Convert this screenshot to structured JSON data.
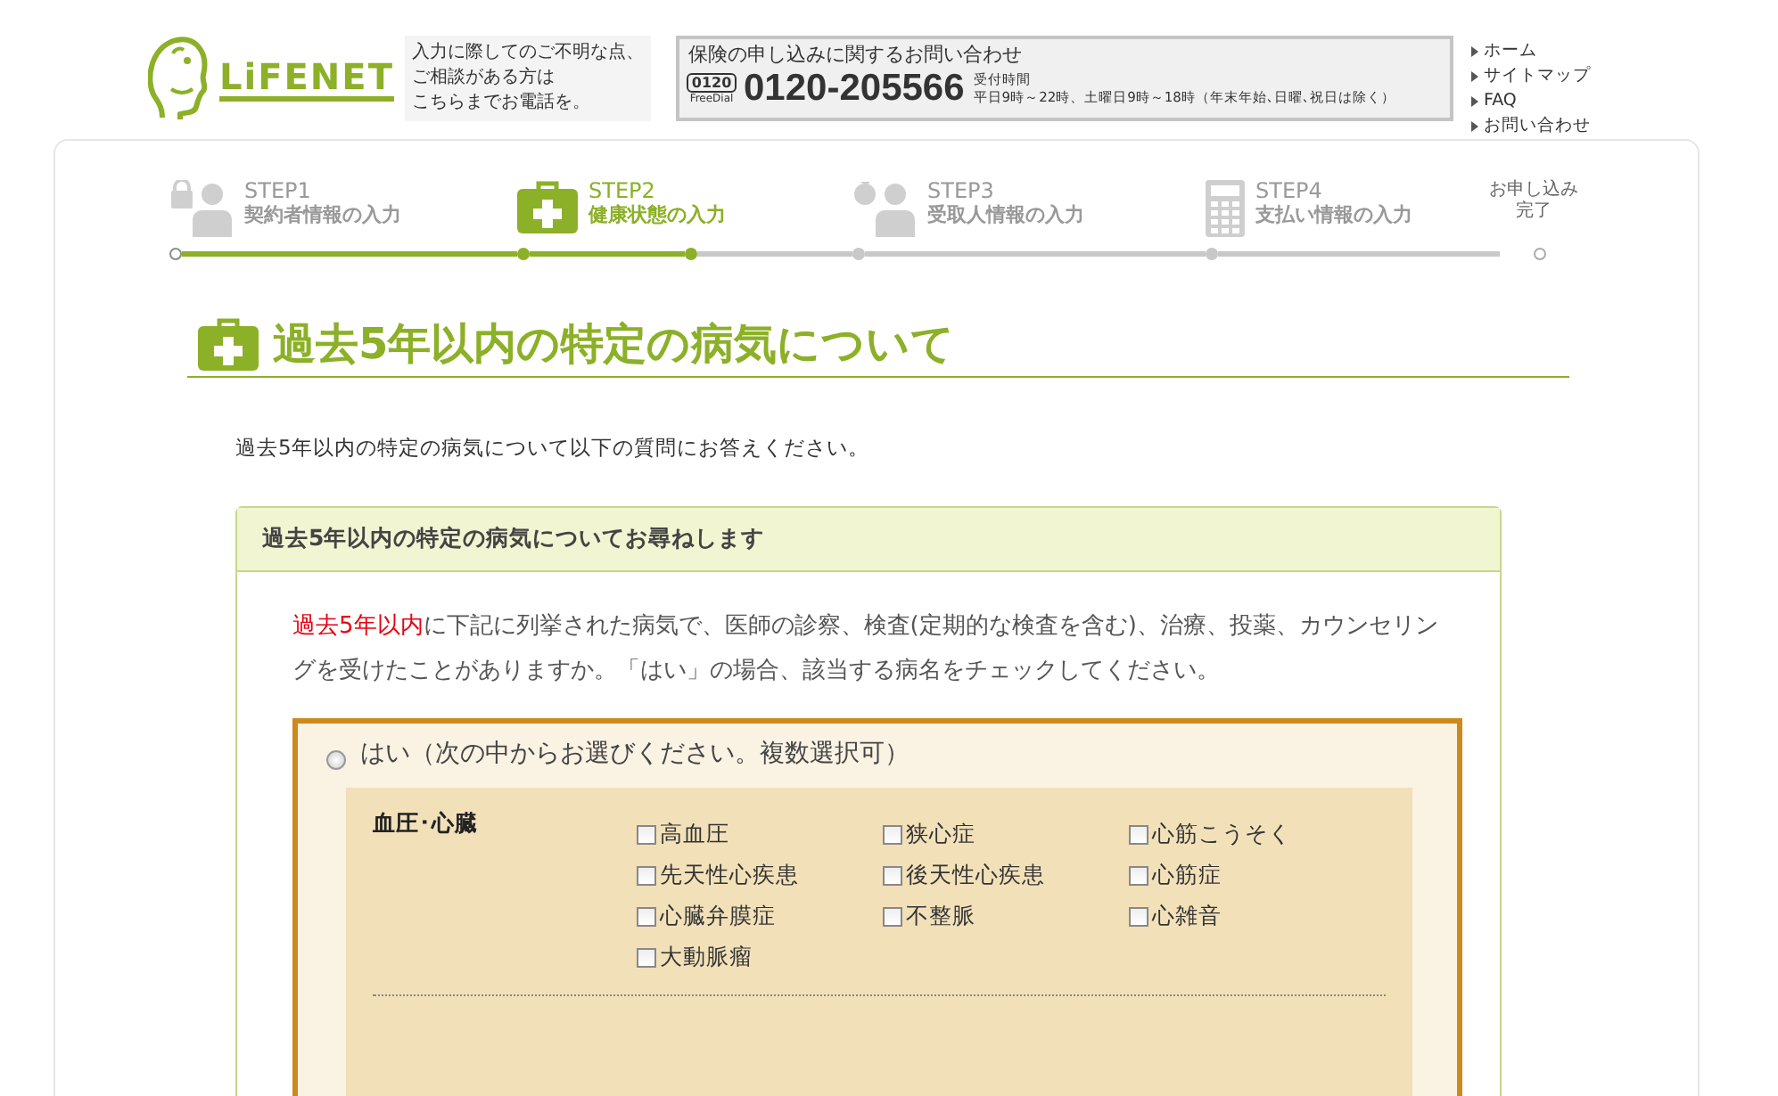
{
  "header": {
    "logo_text": "LiFENET",
    "notice": [
      "入力に際してのご不明な点、",
      "ご相談がある方は",
      "こちらまでお電話を。"
    ],
    "contact": {
      "title": "保険の申し込みに関するお問い合わせ",
      "freedial_mark": "0120",
      "freedial_label": "FreeDial",
      "phone": "0120-205566",
      "hours_label": "受付時間",
      "hours": "平日9時～22時、土曜日9時～18時（年末年始､日曜､祝日は除く）"
    },
    "links": [
      "ホーム",
      "サイトマップ",
      "FAQ",
      "お問い合わせ"
    ]
  },
  "steps": [
    {
      "kind": "lock-person",
      "step": "STEP1",
      "label": "契約者情報の入力",
      "completed": true,
      "selected": false
    },
    {
      "kind": "medkit",
      "step": "STEP2",
      "label": "健康状態の入力",
      "completed": false,
      "selected": true
    },
    {
      "kind": "money-person",
      "step": "STEP3",
      "label": "受取人情報の入力",
      "completed": false,
      "selected": false
    },
    {
      "kind": "calculator",
      "step": "STEP4",
      "label": "支払い情報の入力",
      "completed": false,
      "selected": false
    },
    {
      "kind": "finish",
      "label": "お申し込み完了",
      "completed": false,
      "selected": false
    }
  ],
  "page_title": "過去5年以内の特定の病気について",
  "intro": "過去5年以内の特定の病気について以下の質問にお答えください。",
  "panel": {
    "title": "過去5年以内の特定の病気についてお尋ねします",
    "question": [
      {
        "text": "過去5年以内",
        "highlight": true
      },
      {
        "text": "に下記に列挙された病気で、医師の診察、検査(定期的な検査を含む)、治療、投薬、カウンセリングを受けたことがありますか。「はい」の場合、該当する病名をチェックしてください。",
        "highlight": false
      }
    ],
    "yes_option": {
      "label": "はい（次の中からお選びください。複数選択可）",
      "selected": false
    },
    "categories": [
      {
        "name": "血圧･心臓",
        "items": [
          {
            "label": "高血圧",
            "checked": false
          },
          {
            "label": "狭心症",
            "checked": false
          },
          {
            "label": "心筋こうそく",
            "checked": false
          },
          {
            "label": "先天性心疾患",
            "checked": false
          },
          {
            "label": "後天性心疾患",
            "checked": false
          },
          {
            "label": "心筋症",
            "checked": false
          },
          {
            "label": "心臓弁膜症",
            "checked": false
          },
          {
            "label": "不整脈",
            "checked": false
          },
          {
            "label": "心雑音",
            "checked": false
          },
          {
            "label": "大動脈瘤",
            "checked": false
          }
        ]
      }
    ]
  }
}
